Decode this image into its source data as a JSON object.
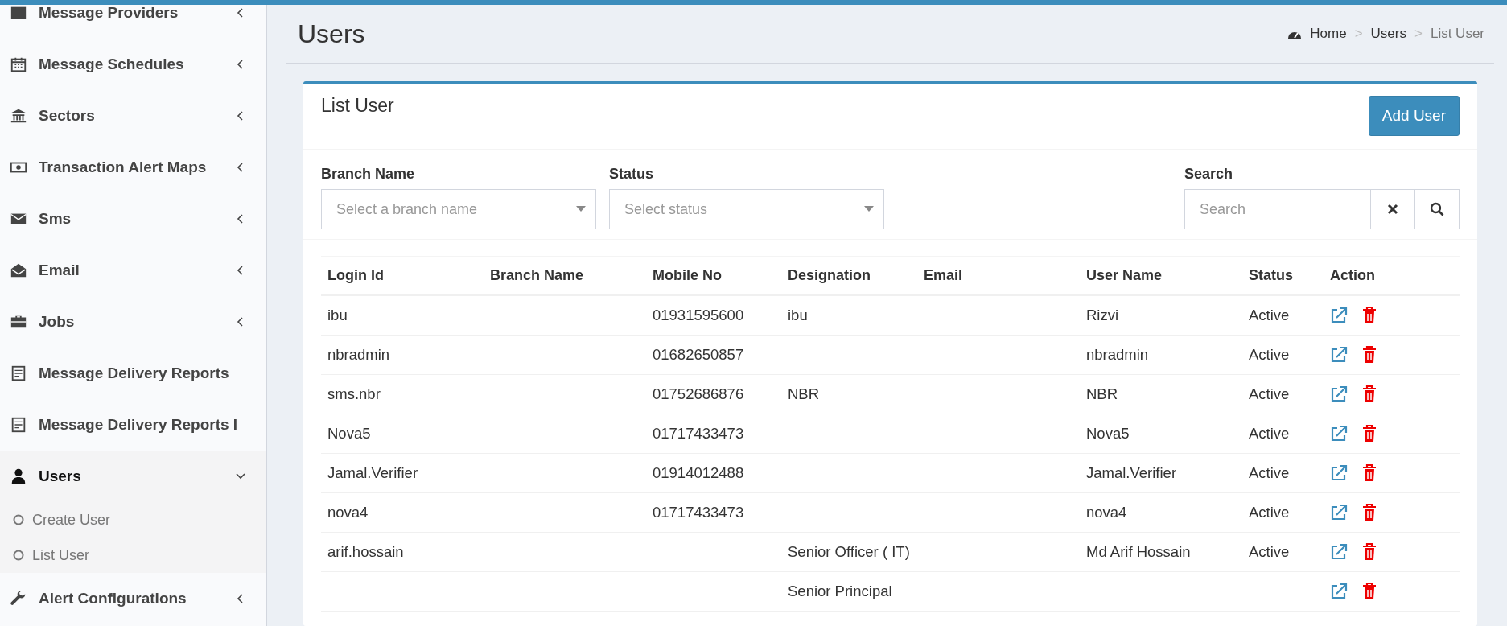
{
  "sidebar": {
    "items": [
      {
        "label": "Message Providers",
        "expanded": false
      },
      {
        "label": "Message Schedules",
        "expanded": false
      },
      {
        "label": "Sectors",
        "expanded": false
      },
      {
        "label": "Transaction Alert Maps",
        "expanded": false
      },
      {
        "label": "Sms",
        "expanded": false
      },
      {
        "label": "Email",
        "expanded": false
      },
      {
        "label": "Jobs",
        "expanded": false
      },
      {
        "label": "Message Delivery Reports"
      },
      {
        "label": "Message Delivery Reports I"
      },
      {
        "label": "Users",
        "expanded": true,
        "children": [
          {
            "label": "Create User"
          },
          {
            "label": "List User"
          }
        ]
      },
      {
        "label": "Alert Configurations",
        "expanded": false
      }
    ]
  },
  "page_header": {
    "title": "Users",
    "breadcrumb": [
      {
        "label": "Home",
        "active": false
      },
      {
        "separator": ">",
        "label": "Users",
        "active": false
      },
      {
        "separator": ">",
        "label": "List User",
        "active": true
      }
    ]
  },
  "box": {
    "title": "List User",
    "add_button": "Add User",
    "filters": [
      {
        "label": "Branch Name",
        "placeholder": "Select a branch name"
      },
      {
        "label": "Status",
        "placeholder": "Select status"
      }
    ],
    "search": {
      "label": "Search",
      "placeholder": "Search"
    },
    "table": {
      "columns": [
        {
          "kind": "text",
          "label": "Login Id"
        },
        {
          "kind": "text",
          "label": "Branch Name"
        },
        {
          "kind": "text",
          "label": "Mobile No"
        },
        {
          "kind": "text",
          "label": "Designation"
        },
        {
          "kind": "text",
          "label": "Email"
        },
        {
          "kind": "text",
          "label": "User Name"
        },
        {
          "kind": "text",
          "label": "Status"
        },
        {
          "kind": "action",
          "label": "Action"
        }
      ],
      "rows": [
        {
          "cells": [
            "ibu",
            null,
            "01931595600",
            "ibu",
            null,
            "Rizvi",
            "Active"
          ]
        },
        {
          "cells": [
            "nbradmin",
            null,
            "01682650857",
            null,
            null,
            "nbradmin",
            "Active"
          ]
        },
        {
          "cells": [
            "sms.nbr",
            null,
            "01752686876",
            "NBR",
            null,
            "NBR",
            "Active"
          ]
        },
        {
          "cells": [
            "Nova5",
            null,
            "01717433473",
            null,
            null,
            "Nova5",
            "Active"
          ]
        },
        {
          "cells": [
            "Jamal.Verifier",
            null,
            "01914012488",
            null,
            null,
            "Jamal.Verifier",
            "Active"
          ]
        },
        {
          "cells": [
            "nova4",
            null,
            "01717433473",
            null,
            null,
            "nova4",
            "Active"
          ]
        },
        {
          "cells": [
            "arif.hossain",
            null,
            null,
            "Senior Officer ( IT)",
            null,
            "Md Arif Hossain",
            "Active"
          ]
        },
        {
          "cells": [
            null,
            null,
            null,
            "Senior Principal"
          ]
        }
      ]
    }
  }
}
